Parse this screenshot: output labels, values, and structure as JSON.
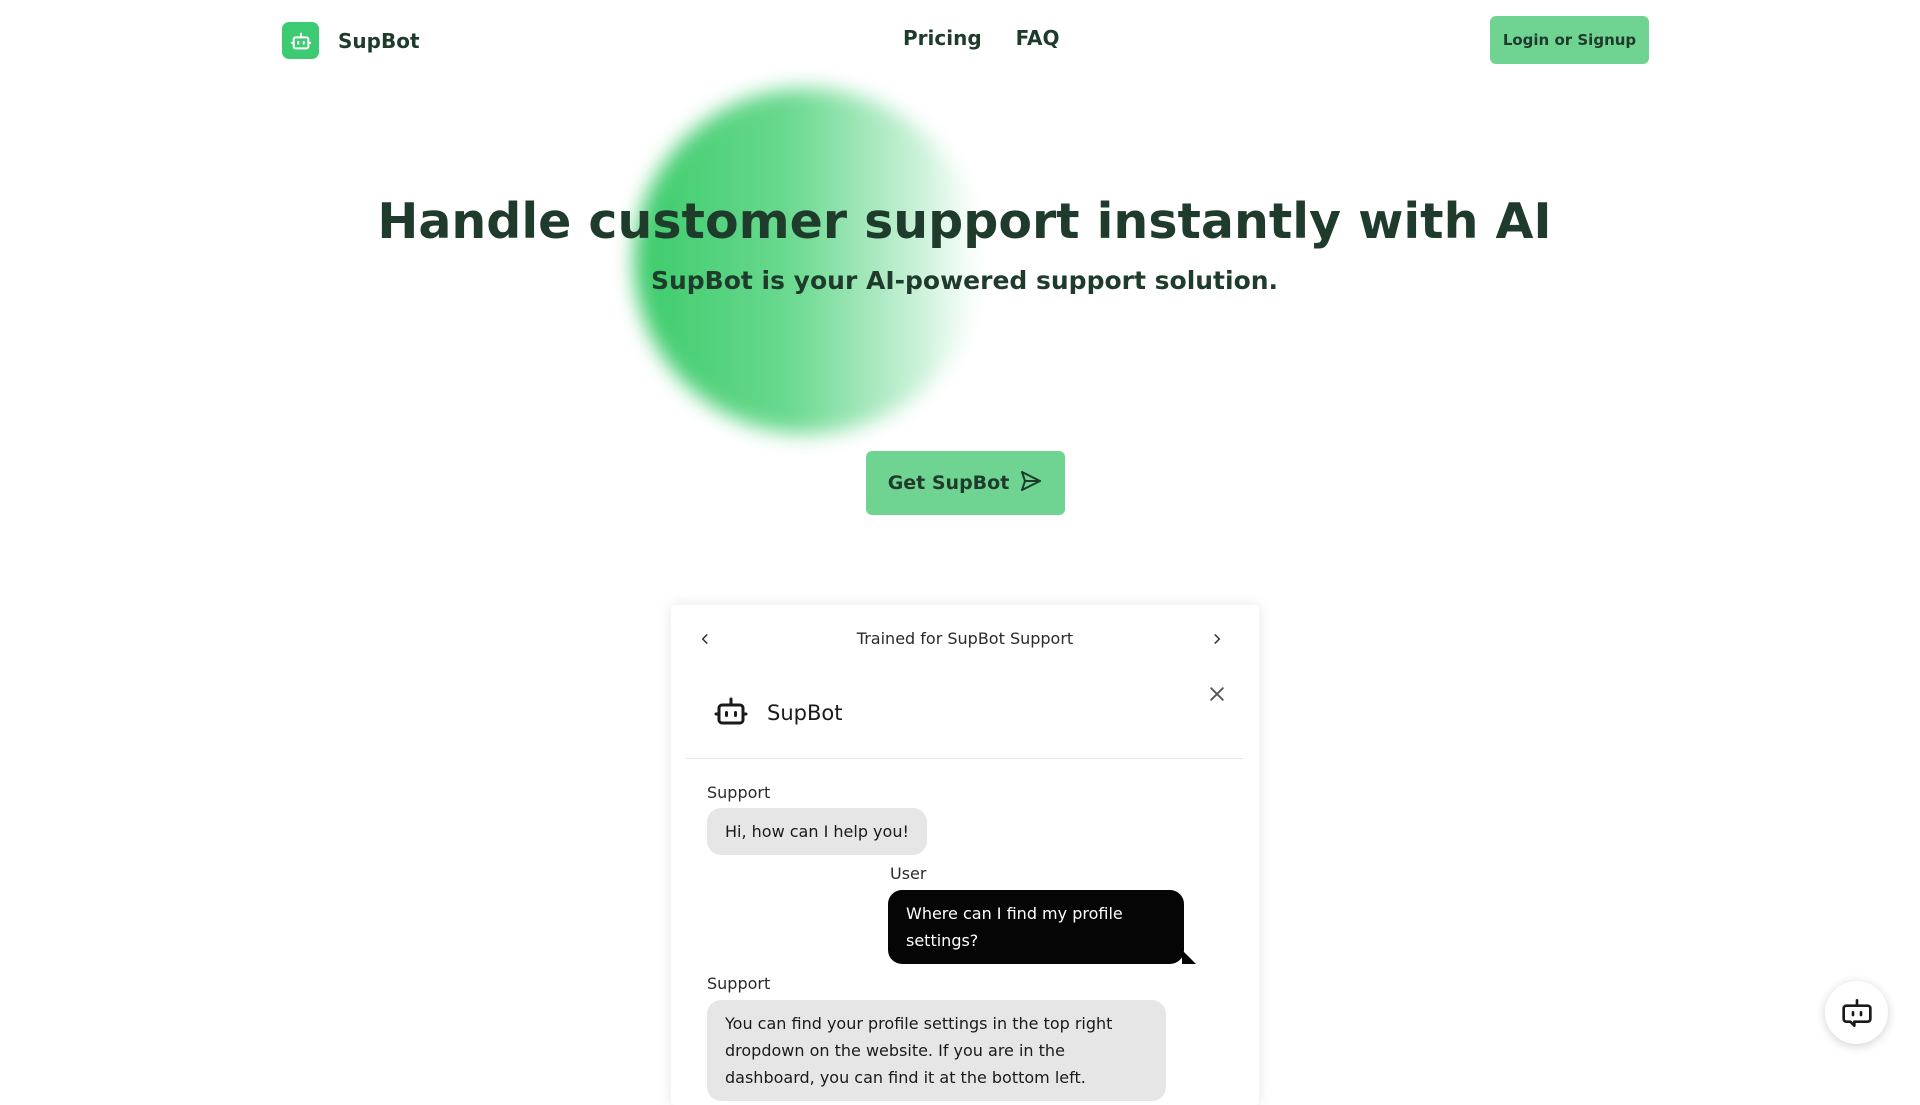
{
  "header": {
    "brand_name": "SupBot",
    "nav": [
      {
        "label": "Pricing"
      },
      {
        "label": "FAQ"
      }
    ],
    "login_label": "Login or Signup"
  },
  "hero": {
    "title": "Handle customer support instantly with AI",
    "subtitle": "SupBot is your AI-powered support solution.",
    "cta_label": "Get SupBot",
    "cta_icon": "send-icon"
  },
  "demo": {
    "carousel_title": "Trained for SupBot Support",
    "widget_name": "SupBot",
    "messages": [
      {
        "sender": "Support",
        "text": "Hi, how can I help you!"
      },
      {
        "sender": "User",
        "text": "Where can I find my profile settings?"
      },
      {
        "sender": "Support",
        "text": "You can find your profile settings in the top right dropdown on the website. If you are in the dashboard, you can find it at the bottom left."
      }
    ]
  },
  "colors": {
    "brand_green": "#3ccb73",
    "button_green": "#6fd391",
    "text_dark": "#1f3b2c",
    "user_bubble": "#050505",
    "support_bubble": "#e6e6e6"
  },
  "icons": {
    "brand": "robot-icon",
    "prev": "chevron-left-icon",
    "next": "chevron-right-icon",
    "close": "close-icon",
    "launcher": "chat-bot-icon"
  }
}
